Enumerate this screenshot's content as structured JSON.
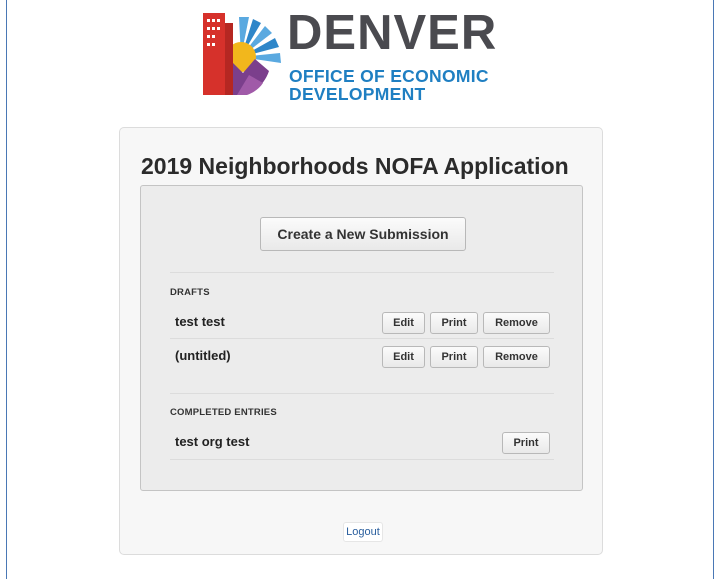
{
  "brand": {
    "wordmark": "DENVER",
    "subtitle_line1": "OFFICE OF ECONOMIC",
    "subtitle_line2": "DEVELOPMENT"
  },
  "page": {
    "title": "2019 Neighborhoods NOFA Application"
  },
  "actions": {
    "create_label": "Create a New Submission",
    "logout_label": "Logout"
  },
  "drafts": {
    "label": "DRAFTS",
    "items": [
      {
        "name": "test test",
        "edit": "Edit",
        "print": "Print",
        "remove": "Remove"
      },
      {
        "name": "(untitled)",
        "edit": "Edit",
        "print": "Print",
        "remove": "Remove"
      }
    ]
  },
  "completed": {
    "label": "COMPLETED ENTRIES",
    "items": [
      {
        "name": "test org test",
        "print": "Print"
      }
    ]
  },
  "colors": {
    "brand_gray": "#4a4a4f",
    "brand_blue": "#1f7fc2",
    "link": "#2a5f9e"
  }
}
